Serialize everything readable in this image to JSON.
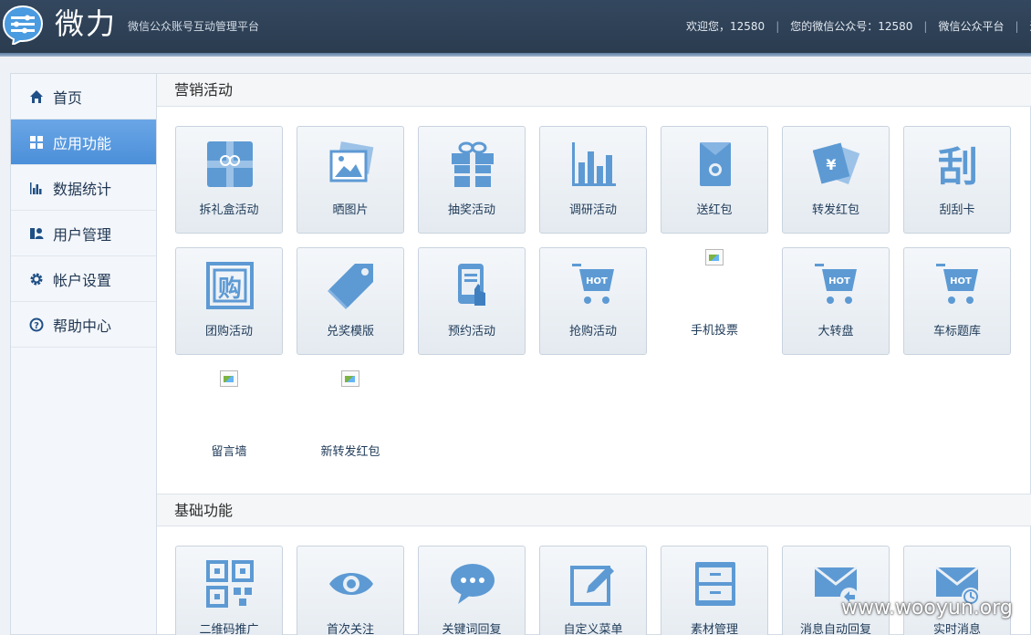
{
  "header": {
    "brand": "微力",
    "tagline": "微信公众账号互动管理平台",
    "welcome": "欢迎您，12580",
    "account": "您的微信公众号：12580",
    "platform_link": "微信公众平台",
    "logout_partial": "退"
  },
  "sidebar": {
    "items": [
      {
        "label": "首页",
        "icon": "home-icon"
      },
      {
        "label": "应用功能",
        "icon": "grid-icon",
        "active": true
      },
      {
        "label": "数据统计",
        "icon": "bar-chart-icon"
      },
      {
        "label": "用户管理",
        "icon": "users-icon"
      },
      {
        "label": "帐户设置",
        "icon": "gear-icon"
      },
      {
        "label": "帮助中心",
        "icon": "help-icon"
      }
    ]
  },
  "marketing": {
    "title": "营销活动",
    "tiles": [
      {
        "label": "拆礼盒活动",
        "icon": "gift-box-icon"
      },
      {
        "label": "晒图片",
        "icon": "photos-icon"
      },
      {
        "label": "抽奖活动",
        "icon": "present-icon"
      },
      {
        "label": "调研活动",
        "icon": "bar-chart-icon"
      },
      {
        "label": "送红包",
        "icon": "envelope-coin-icon"
      },
      {
        "label": "转发红包",
        "icon": "yen-envelope-icon"
      },
      {
        "label": "刮刮卡",
        "icon": "scratch-card-icon"
      },
      {
        "label": "团购活动",
        "icon": "group-buy-icon"
      },
      {
        "label": "兑奖模版",
        "icon": "tag-icon"
      },
      {
        "label": "预约活动",
        "icon": "booking-icon"
      },
      {
        "label": "抢购活动",
        "icon": "hot-cart-icon",
        "badge": "HOT"
      },
      {
        "label": "手机投票",
        "icon": "broken-image-icon"
      },
      {
        "label": "大转盘",
        "icon": "hot-cart-icon",
        "badge": "HOT"
      },
      {
        "label": "车标题库",
        "icon": "hot-cart-icon",
        "badge": "HOT"
      },
      {
        "label": "留言墙",
        "icon": "broken-image-icon"
      },
      {
        "label": "新转发红包",
        "icon": "broken-image-icon"
      }
    ]
  },
  "basic": {
    "title": "基础功能",
    "tiles": [
      {
        "label": "二维码推广",
        "icon": "qr-code-icon"
      },
      {
        "label": "首次关注",
        "icon": "eye-icon"
      },
      {
        "label": "关键词回复",
        "icon": "chat-bubble-icon"
      },
      {
        "label": "自定义菜单",
        "icon": "edit-icon"
      },
      {
        "label": "素材管理",
        "icon": "cabinet-icon"
      },
      {
        "label": "消息自动回复",
        "icon": "mail-reply-icon"
      },
      {
        "label": "实时消息",
        "icon": "mail-clock-icon"
      }
    ]
  },
  "watermark": "www.wooyun.org",
  "colors": {
    "accent": "#5b9bd5",
    "active_nav": "#4b8fd9",
    "header": "#2f4259"
  }
}
